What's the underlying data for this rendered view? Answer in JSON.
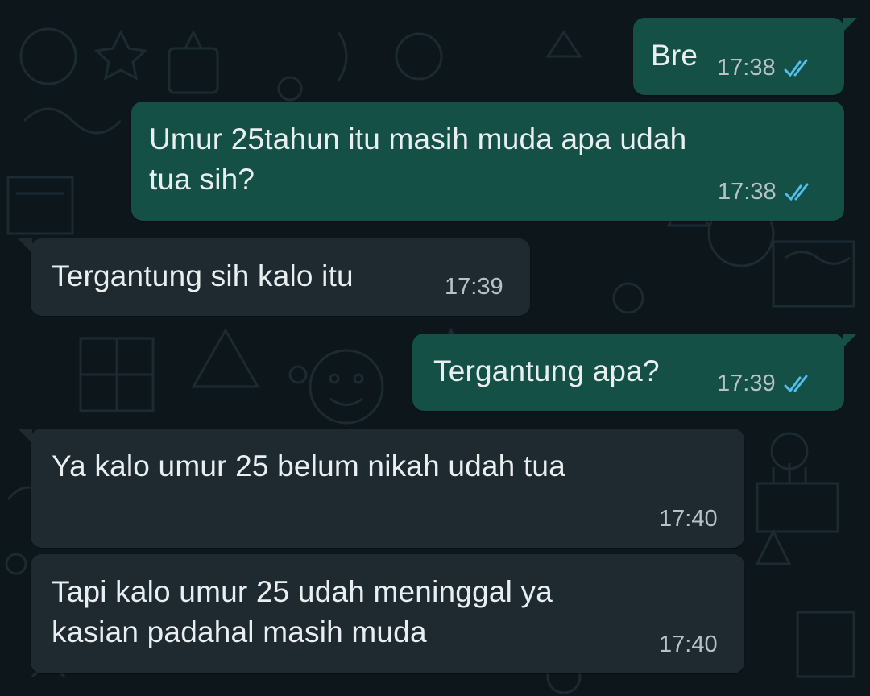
{
  "colors": {
    "background": "#0d161b",
    "outgoing_bubble": "#145045",
    "incoming_bubble": "#1f2a30",
    "read_ticks": "#53bdeb"
  },
  "messages": [
    {
      "direction": "out",
      "text": "Bre",
      "time": "17:38",
      "status_icon": "double-check-read-icon"
    },
    {
      "direction": "out",
      "text": "Umur 25tahun itu masih muda apa udah\ntua sih?",
      "time": "17:38",
      "status_icon": "double-check-read-icon"
    },
    {
      "direction": "in",
      "text": "Tergantung sih kalo itu",
      "time": "17:39"
    },
    {
      "direction": "out",
      "text": "Tergantung apa?",
      "time": "17:39",
      "status_icon": "double-check-read-icon"
    },
    {
      "direction": "in",
      "text": "Ya kalo umur 25 belum nikah udah tua",
      "time": "17:40"
    },
    {
      "direction": "in",
      "text": "Tapi kalo umur 25 udah meninggal ya\nkasian padahal masih muda",
      "time": "17:40"
    }
  ]
}
